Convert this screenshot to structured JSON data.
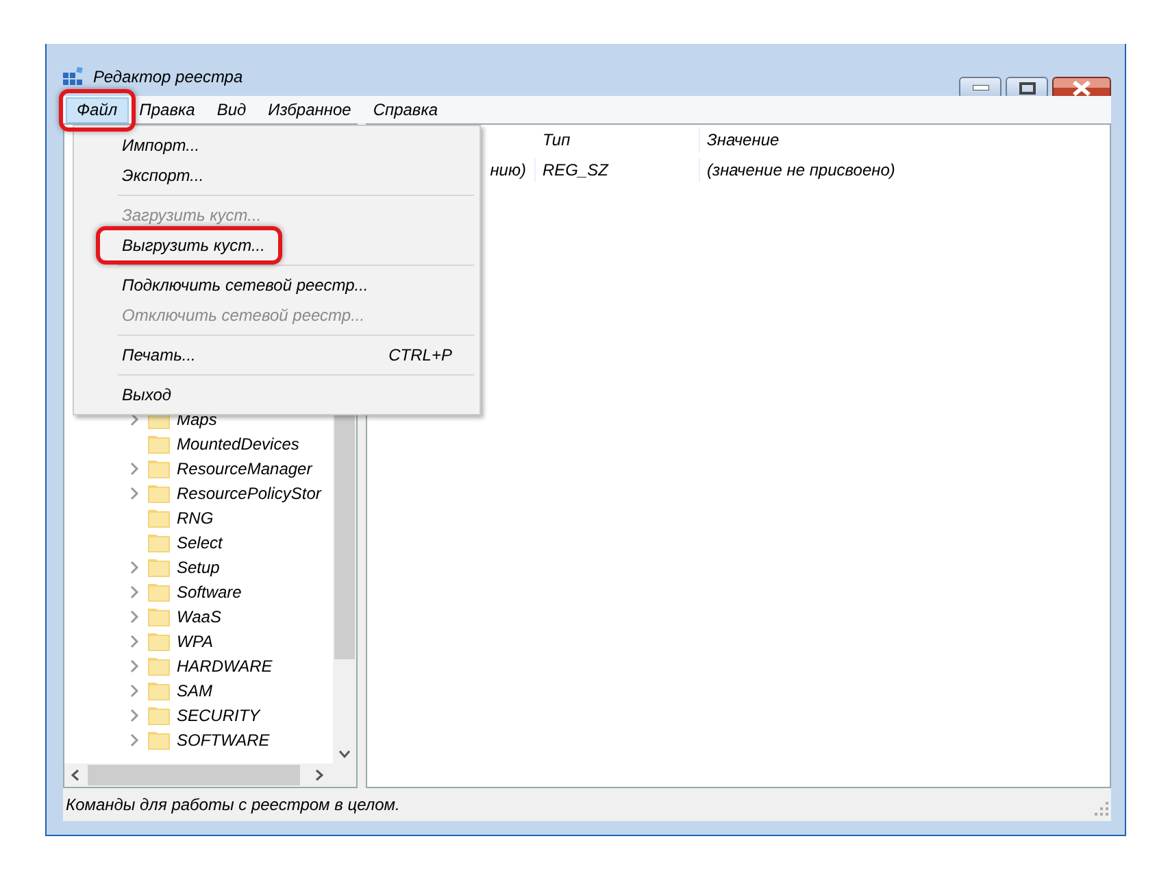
{
  "window": {
    "title": "Редактор реестра"
  },
  "menu_bar": [
    {
      "label": "Файл",
      "selected": true,
      "highlighted": true
    },
    {
      "label": "Правка",
      "selected": false,
      "highlighted": false
    },
    {
      "label": "Вид",
      "selected": false,
      "highlighted": false
    },
    {
      "label": "Избранное",
      "selected": false,
      "highlighted": false
    },
    {
      "label": "Справка",
      "selected": false,
      "highlighted": false
    }
  ],
  "file_menu": {
    "items": [
      {
        "kind": "item",
        "label": "Импорт...",
        "disabled": false,
        "highlighted": false
      },
      {
        "kind": "item",
        "label": "Экспорт...",
        "disabled": false,
        "highlighted": false
      },
      {
        "kind": "separator"
      },
      {
        "kind": "item",
        "label": "Загрузить куст...",
        "disabled": true,
        "highlighted": false
      },
      {
        "kind": "item",
        "label": "Выгрузить куст...",
        "disabled": false,
        "highlighted": true
      },
      {
        "kind": "separator"
      },
      {
        "kind": "item",
        "label": "Подключить сетевой реестр...",
        "disabled": false,
        "highlighted": false
      },
      {
        "kind": "item",
        "label": "Отключить сетевой реестр...",
        "disabled": true,
        "highlighted": false
      },
      {
        "kind": "separator"
      },
      {
        "kind": "item",
        "label": "Печать...",
        "shortcut": "CTRL+P",
        "disabled": false,
        "highlighted": false
      },
      {
        "kind": "separator"
      },
      {
        "kind": "item",
        "label": "Выход",
        "disabled": false,
        "highlighted": false
      }
    ]
  },
  "tree": {
    "nodes": [
      {
        "children": [
          {
            "label": "Maps",
            "expandable": true
          },
          {
            "label": "MountedDevices",
            "expandable": false
          },
          {
            "label": "ResourceManager",
            "expandable": true
          },
          {
            "label": "ResourcePolicyStor",
            "expandable": true
          },
          {
            "label": "RNG",
            "expandable": false
          },
          {
            "label": "Select",
            "expandable": false
          },
          {
            "label": "Setup",
            "expandable": true
          },
          {
            "label": "Software",
            "expandable": true
          },
          {
            "label": "WaaS",
            "expandable": true
          },
          {
            "label": "WPA",
            "expandable": true
          }
        ]
      },
      {
        "label": "HARDWARE",
        "expandable": true
      },
      {
        "label": "SAM",
        "expandable": true
      },
      {
        "label": "SECURITY",
        "expandable": true
      },
      {
        "label": "SOFTWARE",
        "expandable": true
      }
    ]
  },
  "values_table": {
    "columns": [
      null,
      {
        "label": "Тип"
      },
      {
        "label": "Значение"
      }
    ],
    "rows": [
      {
        "cells": [
          "нию)",
          "REG_SZ",
          "(значение не присвоено)"
        ]
      }
    ]
  },
  "status_bar": "Команды для работы с реестром в целом."
}
